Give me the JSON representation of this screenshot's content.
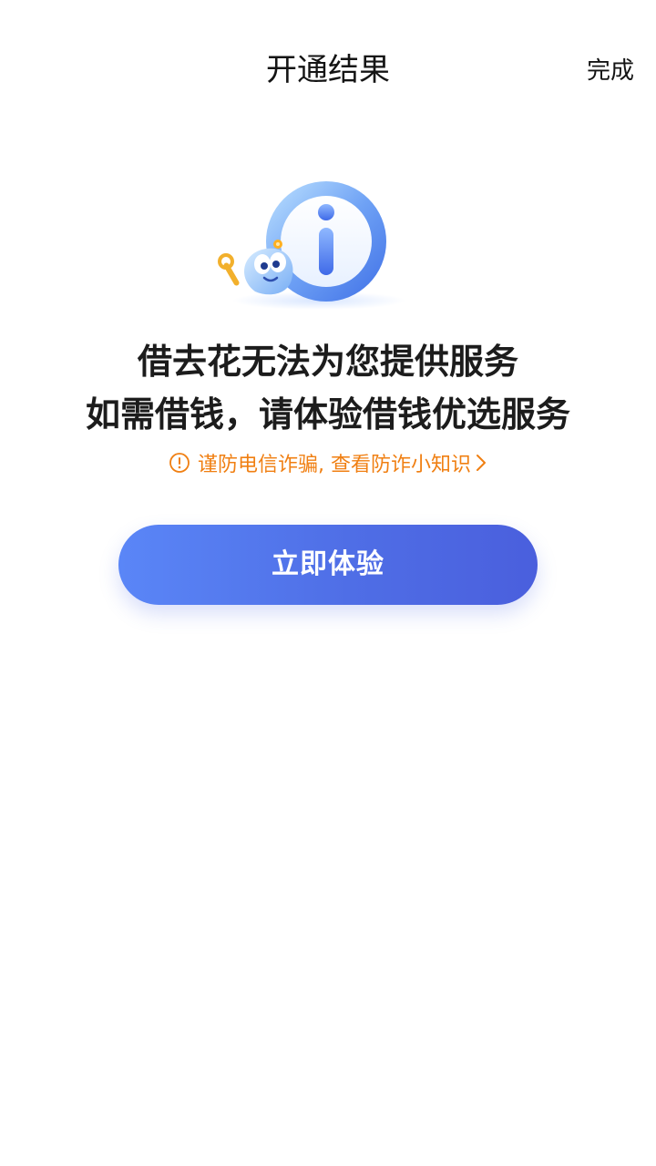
{
  "header": {
    "title": "开通结果",
    "done_label": "完成"
  },
  "main": {
    "illustration_icon": "info-mascot-illustration",
    "message_line1": "借去花无法为您提供服务",
    "message_line2": "如需借钱，请体验借钱优选服务",
    "notice_text": "谨防电信诈骗, 查看防诈小知识",
    "cta_label": "立即体验"
  },
  "colors": {
    "accent_blue": "#4f6ee6",
    "warning_orange": "#f07f12",
    "background": "#ffffff"
  }
}
